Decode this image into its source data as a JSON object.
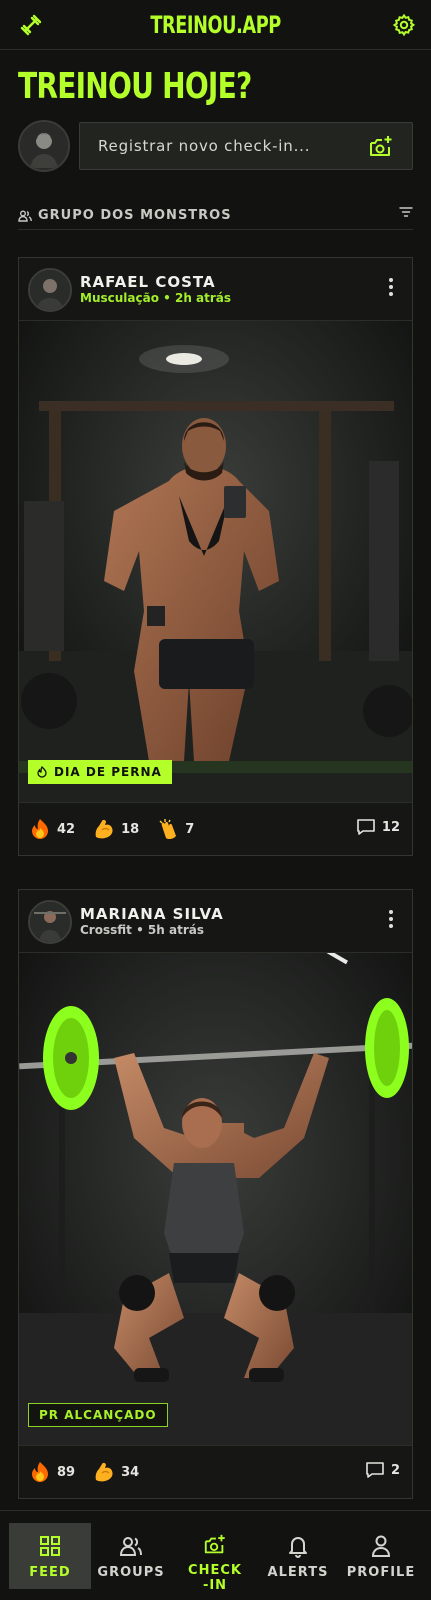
{
  "header": {
    "title": "TREINOU.APP",
    "left_icon": "dumbbell-icon",
    "right_icon": "gear-icon"
  },
  "hero": {
    "title": "TREINOU HOJE?"
  },
  "checkin": {
    "placeholder": "Registrar novo check-in...",
    "icon": "add-photo-icon"
  },
  "group": {
    "name": "GRUPO DOS MONSTROS",
    "icon": "group-icon",
    "filter_icon": "filter-icon"
  },
  "posts": [
    {
      "author": "RAFAEL COSTA",
      "category": "Musculação",
      "time": "2h atrás",
      "tag": "DIA DE PERNA",
      "tag_style": "solid",
      "reactions": [
        {
          "emoji": "fire",
          "count": "42"
        },
        {
          "emoji": "flexed-biceps",
          "count": "18"
        },
        {
          "emoji": "clapping-hands",
          "count": "7"
        }
      ],
      "comments": "12"
    },
    {
      "author": "MARIANA SILVA",
      "category": "Crossfit",
      "time": "5h atrás",
      "tag": "PR ALCANÇADO",
      "tag_style": "outline",
      "reactions": [
        {
          "emoji": "fire",
          "count": "89"
        },
        {
          "emoji": "flexed-biceps",
          "count": "34"
        }
      ],
      "comments": "2"
    }
  ],
  "meta_separator": " • ",
  "nav": [
    {
      "label": "FEED",
      "icon": "grid-icon",
      "active": true
    },
    {
      "label": "GROUPS",
      "icon": "users-icon",
      "active": false
    },
    {
      "label": "CHECK-IN",
      "icon": "add-photo-icon",
      "active": false
    },
    {
      "label": "ALERTS",
      "icon": "bell-icon",
      "active": false
    },
    {
      "label": "PROFILE",
      "icon": "user-icon",
      "active": false
    }
  ],
  "colors": {
    "accent": "#b4ff2a",
    "background": "#121311",
    "card": "#161715"
  }
}
